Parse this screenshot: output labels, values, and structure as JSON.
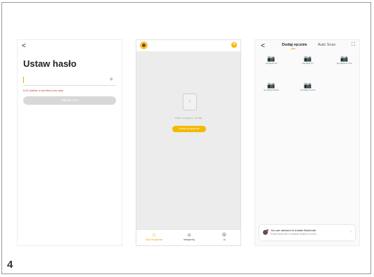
{
  "step_number": "4",
  "screen1": {
    "back_glyph": "<",
    "title": "Ustaw hasło",
    "password_hint": "6-20 znaków, w tym litery oraz cyfry",
    "complete_button": "Zakończono"
  },
  "screen2": {
    "empty_text": "Brak urządzeń, dodaj",
    "add_device_button": "Dodaj urządzenie",
    "tabs": [
      {
        "label": "Moje Urządzenia",
        "icon": "home-icon",
        "glyph": "⌂"
      },
      {
        "label": "Inteligentny",
        "icon": "smart-icon",
        "glyph": "☼"
      },
      {
        "label": "Ja",
        "icon": "profile-icon",
        "glyph": "☺"
      }
    ],
    "accent_color": "#f5b800"
  },
  "screen3": {
    "back_glyph": "<",
    "tab_manual": "Dodaj ręcznie",
    "tab_auto": "Auto Scan",
    "scan_glyph": "⛶",
    "cameras": [
      {
        "name": "Gorrapid 3.6",
        "glyph": "📷"
      },
      {
        "name": "Gorrapid 3.7",
        "glyph": "📷"
      },
      {
        "name": "Gorrapid 3.7 Pro",
        "glyph": "📷"
      },
      {
        "name": "Gorrapid 4.8 Pro",
        "glyph": "📷"
      },
      {
        "name": "Gorrapid 4.0 Pro",
        "glyph": "📷"
      }
    ],
    "bluetooth_title": "You are advised to enable Bluetooth.",
    "bluetooth_sub": "Enable Bluetooth to facilitate addition of some...",
    "chevron_glyph": "›"
  }
}
